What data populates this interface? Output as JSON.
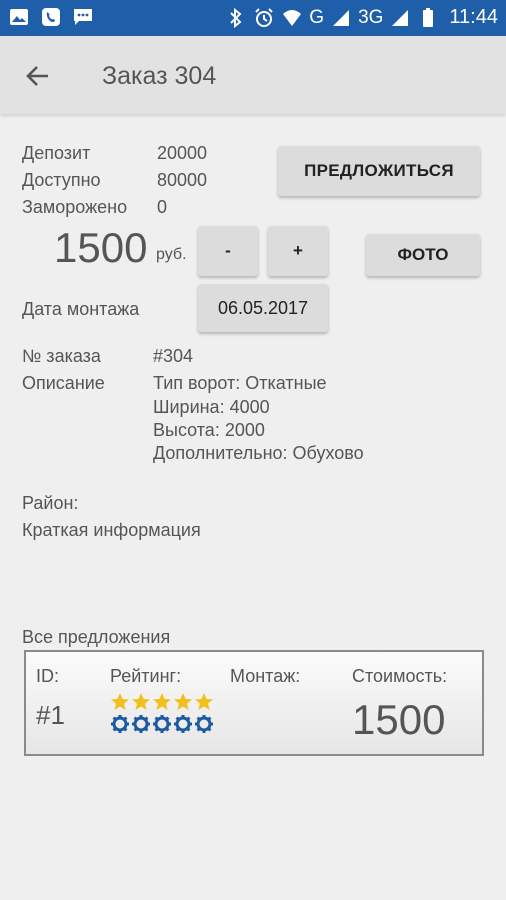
{
  "status_bar": {
    "network": "G",
    "network2": "3G",
    "time": "11:44"
  },
  "app_bar": {
    "title": "Заказ 304"
  },
  "balance": {
    "deposit_label": "Депозит",
    "deposit_value": "20000",
    "available_label": "Доступно",
    "available_value": "80000",
    "frozen_label": "Заморожено",
    "frozen_value": "0"
  },
  "offer_button_label": "ПРЕДЛОЖИТЬСЯ",
  "price": {
    "amount": "1500",
    "currency": "руб.",
    "minus_label": "-",
    "plus_label": "+"
  },
  "photo_button_label": "ФОТО",
  "install_date": {
    "label": "Дата монтажа",
    "value": "06.05.2017"
  },
  "order": {
    "number_label": "№ заказа",
    "number_value": "#304",
    "description_label": "Описание",
    "description_lines": [
      "Тип ворот: Откатные",
      "Ширина: 4000",
      "Высота: 2000",
      "Дополнительно: Обухово"
    ],
    "district_label": "Район:",
    "brief_info_label": "Краткая информация"
  },
  "offers": {
    "section_title": "Все предложения",
    "id_header": "ID:",
    "rating_header": "Рейтинг:",
    "install_header": "Монтаж:",
    "cost_header": "Стоимость:",
    "items": [
      {
        "id": "#1",
        "rating_stars": 5,
        "rating_gears": 5,
        "install": "",
        "cost": "1500"
      }
    ]
  },
  "colors": {
    "status_bar": "#1f5ea8",
    "app_bar": "#e2e2e2",
    "background": "#efefef",
    "star": "#f2c01e",
    "gear": "#1e5aa0"
  }
}
